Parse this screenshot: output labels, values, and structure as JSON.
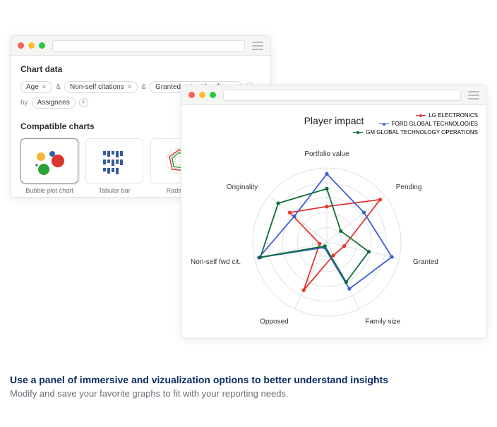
{
  "window1": {
    "section_title": "Chart data",
    "chips": [
      "Age",
      "Non-self citations",
      "Granted patent families"
    ],
    "amp": "&",
    "by": "by",
    "by_chip": "Assignees",
    "compatible_title": "Compatible charts",
    "cards": [
      {
        "label": "Bubble plot chart"
      },
      {
        "label": "Tabular bar"
      },
      {
        "label": "Radar ch"
      }
    ]
  },
  "window2": {
    "title": "Player impact",
    "legend": [
      {
        "name": "LG ELECTRONICS",
        "color": "#e4342e"
      },
      {
        "name": "FORD GLOBAL TECHNOLOGIES",
        "color": "#3d5fd6"
      },
      {
        "name": "GM GLOBAL TECHNOLOGY OPERATIONS",
        "color": "#0f6e35"
      }
    ],
    "axes": [
      "Portfolio value",
      "Pending",
      "Granted",
      "Family size",
      "Opposed",
      "Non-self fwd cit.",
      "Originality"
    ]
  },
  "chart_data": {
    "type": "radar",
    "title": "Player impact",
    "axes": [
      "Portfolio value",
      "Pending",
      "Granted",
      "Family size",
      "Opposed",
      "Non-self fwd cit.",
      "Originality"
    ],
    "range": [
      0,
      5
    ],
    "rings": 5,
    "series": [
      {
        "name": "LG ELECTRONICS",
        "color": "#e4342e",
        "values": [
          2.4,
          4.6,
          1.2,
          1.0,
          3.6,
          0.5,
          3.2
        ]
      },
      {
        "name": "FORD GLOBAL TECHNOLOGIES",
        "color": "#3d5fd6",
        "values": [
          4.6,
          3.2,
          4.5,
          3.5,
          0.4,
          4.7,
          2.8
        ]
      },
      {
        "name": "GM GLOBAL TECHNOLOGY OPERATIONS",
        "color": "#0f6e35",
        "values": [
          3.6,
          1.2,
          2.9,
          3.0,
          0.3,
          4.6,
          4.2
        ]
      }
    ]
  },
  "caption": {
    "line1": "Use a panel of immersive and vizualization options to better understand insights",
    "line2": "Modify and save your favorite graphs to fit with your reporting needs."
  }
}
